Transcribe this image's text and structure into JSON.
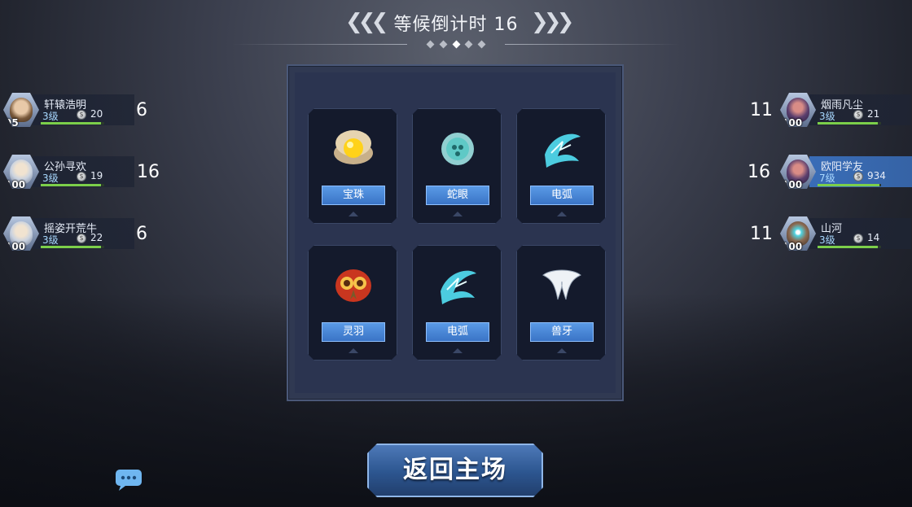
{
  "header": {
    "title": "等候倒计时 16"
  },
  "players_left": [
    {
      "name": "轩辕浩明",
      "hp": "95",
      "level": "3级",
      "coins": "20",
      "score": "6",
      "xp": 0.95
    },
    {
      "name": "公孙寻欢",
      "hp": "100",
      "level": "3级",
      "coins": "19",
      "score": "16",
      "xp": 0.95
    },
    {
      "name": "摇姿开荒牛",
      "hp": "100",
      "level": "3级",
      "coins": "22",
      "score": "6",
      "xp": 0.95
    }
  ],
  "players_right": [
    {
      "name": "烟雨凡尘",
      "hp": "100",
      "level": "3级",
      "coins": "21",
      "score": "11",
      "xp": 0.95
    },
    {
      "name": "欧阳学友",
      "hp": "100",
      "level": "7级",
      "coins": "934",
      "score": "16",
      "xp": 0.98
    },
    {
      "name": "山河",
      "hp": "100",
      "level": "3级",
      "coins": "14",
      "score": "11",
      "xp": 0.95
    }
  ],
  "items": [
    {
      "label": "宝珠",
      "icon": "pearl-icon"
    },
    {
      "label": "蛇眼",
      "icon": "snake-eye-icon"
    },
    {
      "label": "电弧",
      "icon": "electric-arc-icon"
    },
    {
      "label": "灵羽",
      "icon": "spirit-feather-icon"
    },
    {
      "label": "电弧",
      "icon": "electric-arc-icon"
    },
    {
      "label": "兽牙",
      "icon": "beast-fang-icon"
    }
  ],
  "buttons": {
    "return_label": "返回主场"
  },
  "colors": {
    "accent_blue": "#4a86d8",
    "xp_green": "#7ccf4a",
    "level_text": "#a8d8ff"
  }
}
